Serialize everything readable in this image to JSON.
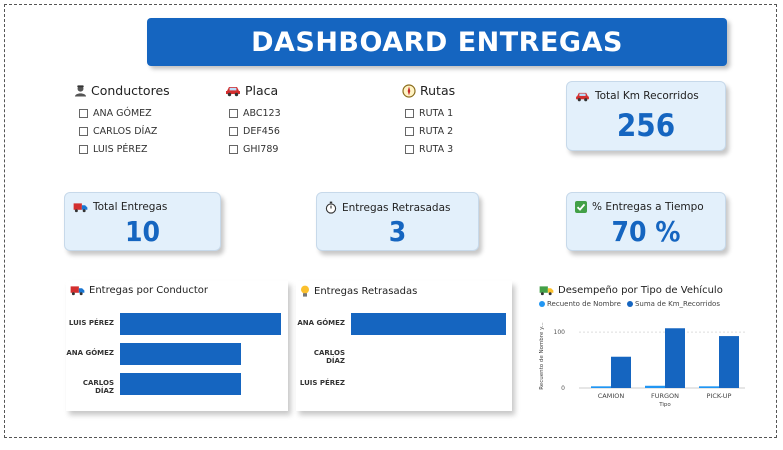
{
  "title": "DASHBOARD ENTREGAS",
  "slicers": {
    "conductores": {
      "title": "Conductores",
      "icon": "driver-icon",
      "items": [
        "ANA GÓMEZ",
        "CARLOS DÍAZ",
        "LUIS PÉREZ"
      ]
    },
    "placa": {
      "title": "Placa",
      "icon": "car-icon",
      "items": [
        "ABC123",
        "DEF456",
        "GHI789"
      ]
    },
    "rutas": {
      "title": "Rutas",
      "icon": "compass-icon",
      "items": [
        "RUTA 1",
        "RUTA 2",
        "RUTA 3"
      ]
    }
  },
  "cards": {
    "km": {
      "label": "Total Km Recorridos",
      "value": "256",
      "icon": "car-icon"
    },
    "entregas": {
      "label": "Total Entregas",
      "value": "10",
      "icon": "truck-icon"
    },
    "retrasadas": {
      "label": "Entregas Retrasadas",
      "value": "3",
      "icon": "stopwatch-icon"
    },
    "a_tiempo": {
      "label": "% Entregas a Tiempo",
      "value": "70 %",
      "icon": "check-icon"
    }
  },
  "colors": {
    "accent": "#1565c0",
    "card_bg": "#e3f0fb",
    "legend_light": "#2196f3"
  },
  "panels": {
    "por_conductor": {
      "title": "Entregas por Conductor",
      "icon": "truck-icon"
    },
    "retrasadas": {
      "title": "Entregas Retrasadas",
      "icon": "lightbulb-icon"
    },
    "tipo_vehiculo": {
      "title": "Desempeño por Tipo de Vehículo",
      "icon": "truck-icon"
    }
  },
  "chart_data": [
    {
      "type": "bar",
      "orientation": "horizontal",
      "title": "Entregas por Conductor",
      "categories": [
        "LUIS PÉREZ",
        "ANA GÓMEZ",
        "CARLOS DÍAZ"
      ],
      "values": [
        4,
        3,
        3
      ]
    },
    {
      "type": "bar",
      "orientation": "horizontal",
      "title": "Entregas Retrasadas",
      "categories": [
        "ANA GÓMEZ",
        "CARLOS DÍAZ",
        "LUIS PÉREZ"
      ],
      "values": [
        3,
        0,
        0
      ]
    },
    {
      "type": "bar",
      "title": "Desempeño por Tipo de Vehículo",
      "categories": [
        "CAMION",
        "FURGON",
        "PICK-UP"
      ],
      "series": [
        {
          "name": "Recuento de Nombre",
          "values": [
            3,
            4,
            3
          ]
        },
        {
          "name": "Suma de Km_Recorridos",
          "values": [
            56,
            107,
            93
          ]
        }
      ],
      "xlabel": "Tipo",
      "ylabel": "Recuento de Nombre y...",
      "yticks": [
        "0",
        "100"
      ],
      "ylim": [
        0,
        120
      ],
      "legend": "top"
    }
  ]
}
